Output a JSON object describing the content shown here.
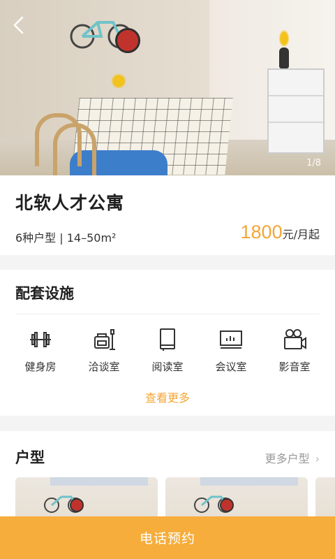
{
  "hero": {
    "page_indicator": "1/8"
  },
  "apartment": {
    "title": "北软人才公寓",
    "meta": "6种户型 | 14–50m²",
    "price_amount": "1800",
    "price_unit": "元/月起"
  },
  "facilities": {
    "title": "配套设施",
    "items": [
      {
        "label": "健身房",
        "icon": "dumbbell-icon"
      },
      {
        "label": "洽谈室",
        "icon": "lounge-chair-icon"
      },
      {
        "label": "阅读室",
        "icon": "book-icon"
      },
      {
        "label": "会议室",
        "icon": "presentation-screen-icon"
      },
      {
        "label": "影音室",
        "icon": "movie-camera-icon"
      }
    ],
    "more_label": "查看更多"
  },
  "layouts": {
    "title": "户型",
    "more_label": "更多户型"
  },
  "cta": {
    "label": "电话预约"
  },
  "colors": {
    "accent": "#f5a536",
    "cta_bg": "#f6ad3b"
  }
}
